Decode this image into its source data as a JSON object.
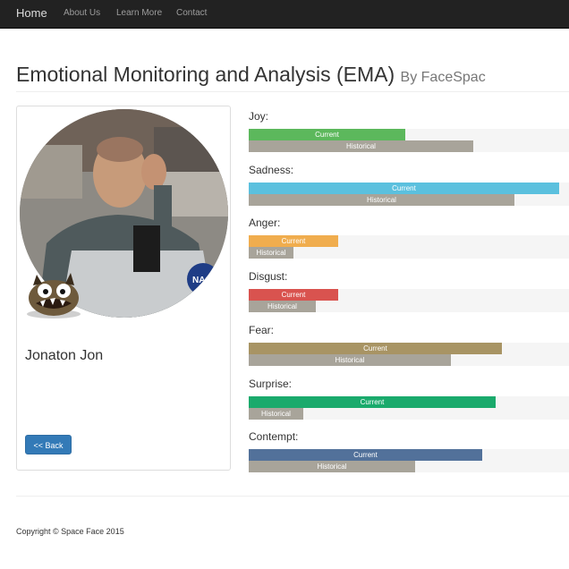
{
  "navbar": {
    "brand": "Home",
    "links": [
      "About Us",
      "Learn More",
      "Contact"
    ]
  },
  "header": {
    "title": "Emotional Monitoring and Analysis (EMA)",
    "subtitle": "By FaceSpac"
  },
  "profile": {
    "name": "Jonaton Jon",
    "back_label": "<< Back"
  },
  "bar_labels": {
    "current": "Current",
    "historical": "Historical"
  },
  "emotions": [
    {
      "label": "Joy:",
      "current": 0.49,
      "historical": 0.7,
      "color": "#5cb85c"
    },
    {
      "label": "Sadness:",
      "current": 0.97,
      "historical": 0.83,
      "color": "#5bc0de"
    },
    {
      "label": "Anger:",
      "current": 0.28,
      "historical": 0.14,
      "color": "#f0ad4e"
    },
    {
      "label": "Disgust:",
      "current": 0.28,
      "historical": 0.21,
      "color": "#d9534f"
    },
    {
      "label": "Fear:",
      "current": 0.79,
      "historical": 0.63,
      "color": "#a89464"
    },
    {
      "label": "Surprise:",
      "current": 0.77,
      "historical": 0.17,
      "color": "#1aaa6c"
    },
    {
      "label": "Contempt:",
      "current": 0.73,
      "historical": 0.52,
      "color": "#52719a"
    }
  ],
  "footer": {
    "copyright": "Copyright © Space Face 2015"
  }
}
